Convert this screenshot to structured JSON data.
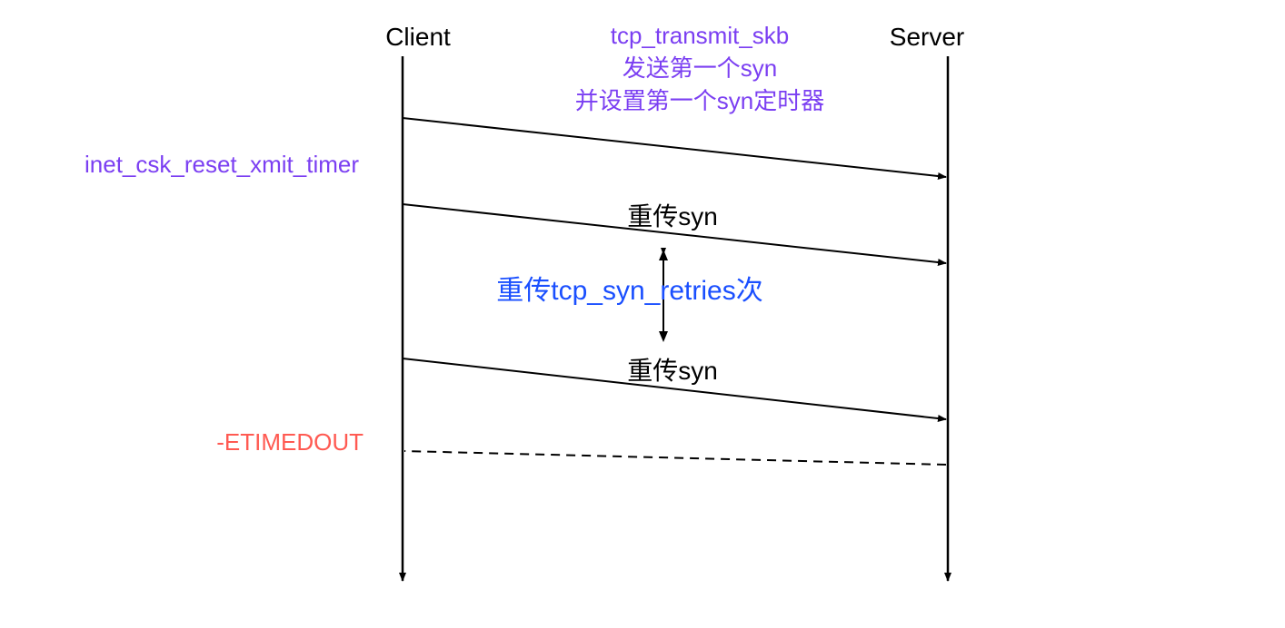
{
  "participants": {
    "client": "Client",
    "server": "Server"
  },
  "notes": {
    "tcp_transmit": "tcp_transmit_skb",
    "send_first_syn": "发送第一个syn",
    "set_timer": "并设置第一个syn定时器",
    "reset_timer": "inet_csk_reset_xmit_timer",
    "retrans_syn": "重传syn",
    "retries": "重传tcp_syn_retries次",
    "etimedout": "-ETIMEDOUT"
  }
}
